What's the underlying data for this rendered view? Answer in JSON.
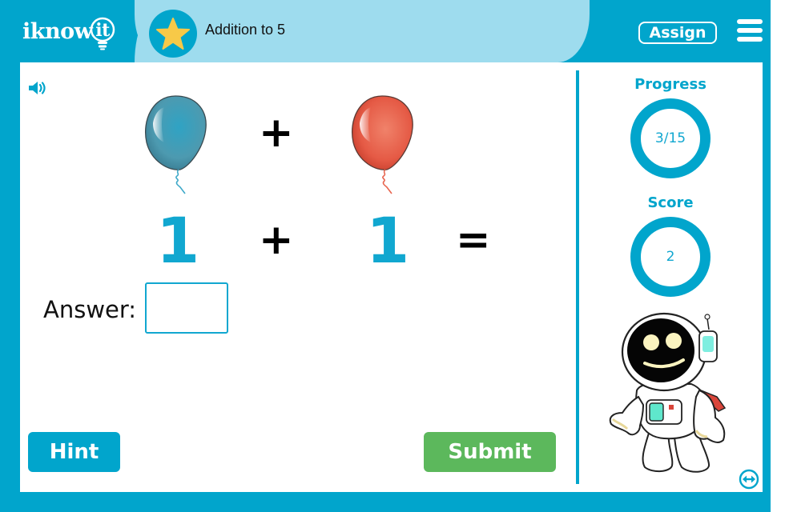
{
  "header": {
    "logo_text": "iknowit",
    "lesson_icon": "star-icon",
    "lesson_title": "Addition to 5",
    "assign_label": "Assign",
    "menu_icon": "hamburger-menu-icon"
  },
  "problem": {
    "sound_icon": "speaker-icon",
    "visual": {
      "left_item": "blue balloon",
      "operator": "+",
      "right_item": "red balloon"
    },
    "equation": {
      "left": "1",
      "operator": "+",
      "right": "1",
      "equals": "="
    },
    "answer_label": "Answer:",
    "answer_value": "",
    "hint_label": "Hint",
    "submit_label": "Submit"
  },
  "sidebar": {
    "progress_title": "Progress",
    "progress_value": "3/15",
    "progress_fraction": 0.2,
    "score_title": "Score",
    "score_value": "2",
    "mascot": "astronaut",
    "swap_icon": "swap-arrows-icon"
  },
  "colors": {
    "brand_blue": "#01a5cc",
    "header_light_blue": "#9edcee",
    "number_blue": "#11a7d0",
    "submit_green": "#5cb85c",
    "star_yellow": "#f7c948"
  }
}
